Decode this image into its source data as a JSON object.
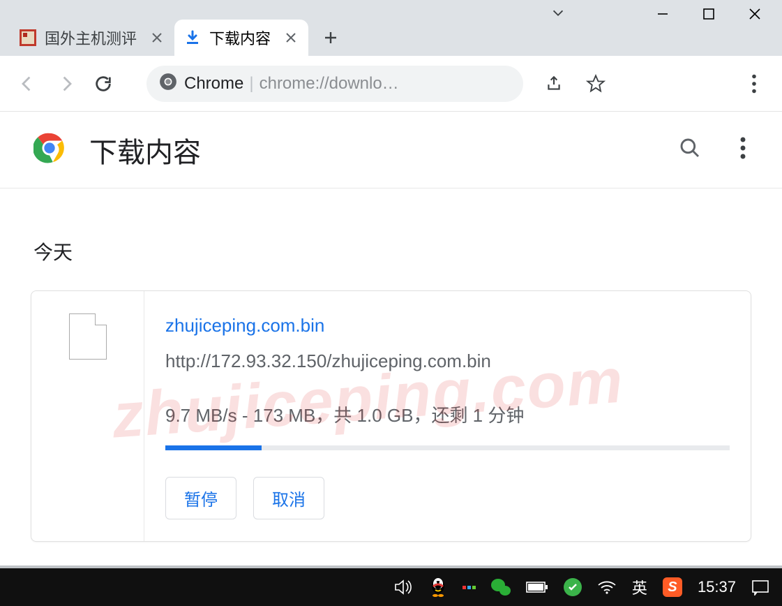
{
  "tabs": [
    {
      "label": "国外主机测评",
      "active": false
    },
    {
      "label": "下载内容",
      "active": true
    }
  ],
  "omnibox": {
    "product": "Chrome",
    "url_display": "chrome://downlo…"
  },
  "page": {
    "title": "下载内容",
    "section": "今天"
  },
  "download": {
    "filename": "zhujiceping.com.bin",
    "url": "http://172.93.32.150/zhujiceping.com.bin",
    "status": "9.7 MB/s - 173 MB，共 1.0 GB，还剩 1 分钟",
    "progress_percent": 17,
    "pause_label": "暂停",
    "cancel_label": "取消"
  },
  "taskbar": {
    "ime": "英",
    "time": "15:37"
  },
  "watermark": "zhujiceping.com",
  "colors": {
    "link": "#1a73e8",
    "muted": "#5f6368"
  }
}
